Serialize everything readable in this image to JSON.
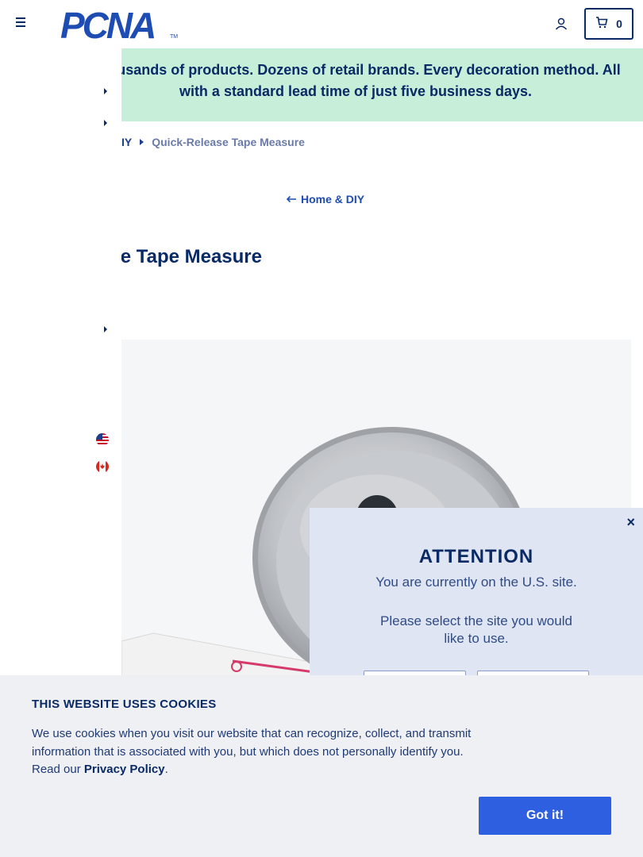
{
  "header": {
    "logo_text": "PCNA",
    "logo_tm": "TM",
    "cart_count": "0"
  },
  "banner": {
    "text": "Thousands of products. Dozens of retail brands. Every decoration method. All with a standard lead time of just five business days."
  },
  "breadcrumb": {
    "parent_partial": "IY",
    "current": "Quick-Release Tape Measure"
  },
  "back_link": {
    "label": "Home & DIY"
  },
  "product": {
    "title_partial": "ase Tape Measure"
  },
  "attention": {
    "close": "×",
    "title": "ATTENTION",
    "message": "You are currently on the U.S. site.",
    "prompt": "Please select the site you would like to use."
  },
  "cookie": {
    "title": "THIS WEBSITE USES COOKIES",
    "text_before": "We use cookies when you visit our website that can recognize, collect, and transmit information that is associated with you, but which does not personally identify you. Read our ",
    "link": "Privacy Policy",
    "text_after": ".",
    "button": "Got it!"
  },
  "colors": {
    "brand_navy": "#0a2a66",
    "banner_green": "#c6eed8",
    "button_blue": "#2d5fe0"
  },
  "icons": [
    "menu-icon",
    "user-icon",
    "cart-icon",
    "caret-right-icon",
    "arrow-left-icon",
    "us-flag-icon",
    "canada-flag-icon",
    "close-icon"
  ]
}
